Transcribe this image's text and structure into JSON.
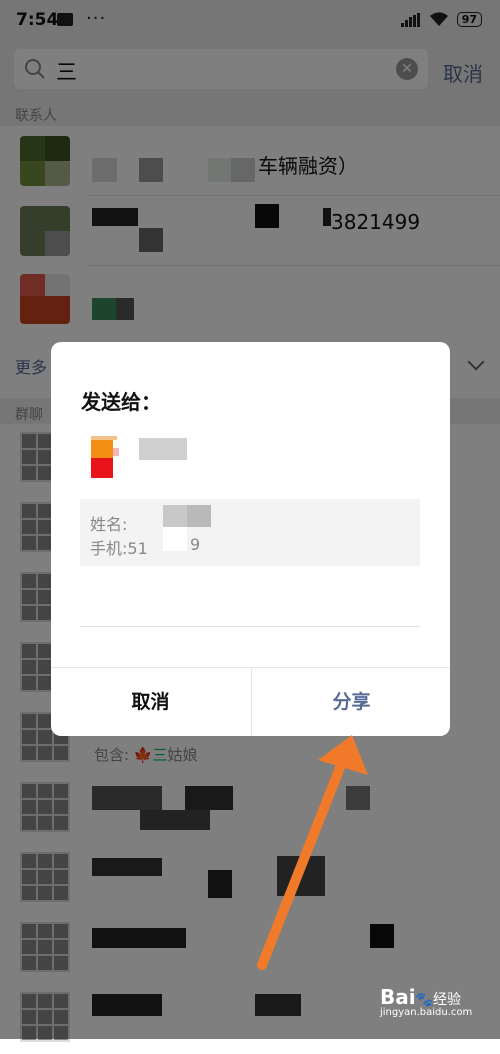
{
  "status": {
    "time": "7:54",
    "dots": "···",
    "battery": "97"
  },
  "search": {
    "query": "三",
    "cancel": "取消"
  },
  "sections": {
    "contacts": "联系人",
    "groups": "群聊",
    "more": "更多"
  },
  "contacts": [
    {
      "suffix": "车辆融资）"
    },
    {
      "suffix": "3821499"
    },
    {
      "suffix": ""
    }
  ],
  "group_preview": {
    "contains_label": "包含:",
    "match": "三",
    "rest": "姑娘"
  },
  "dialog": {
    "title": "发送给：",
    "card_name_label": "姓名:",
    "card_phone_label": "手机:51",
    "card_phone_tail": "9",
    "cancel": "取消",
    "share": "分享"
  },
  "watermark": {
    "brand": "Bai",
    "brand2": "经验",
    "url": "jingyan.baidu.com"
  },
  "colors": {
    "accent": "#576b95",
    "arrow": "#f07a2a"
  }
}
